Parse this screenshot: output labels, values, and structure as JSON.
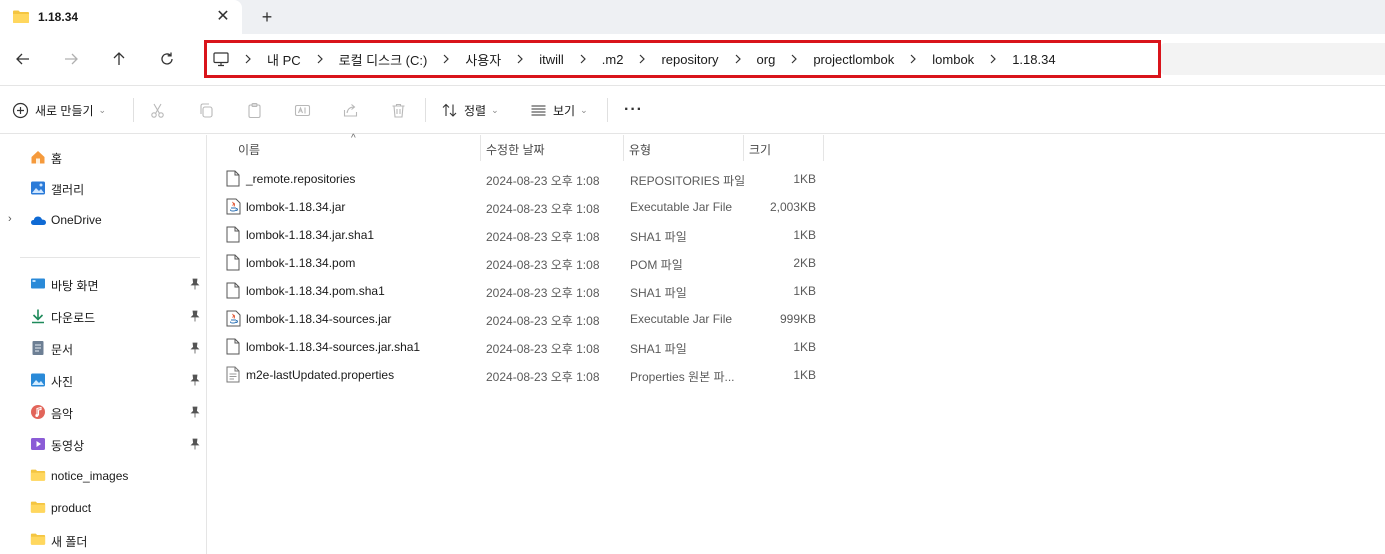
{
  "tab": {
    "title": "1.18.34",
    "close": "✕",
    "new_tab": "+"
  },
  "breadcrumb": [
    "내 PC",
    "로컬 디스크 (C:)",
    "사용자",
    "itwill",
    ".m2",
    "repository",
    "org",
    "projectlombok",
    "lombok",
    "1.18.34"
  ],
  "toolbar": {
    "new_label": "새로 만들기",
    "sort_label": "정렬",
    "view_label": "보기",
    "more_label": "···"
  },
  "sidebar": {
    "items": [
      {
        "label": "홈",
        "icon": "home-icon"
      },
      {
        "label": "갤러리",
        "icon": "gallery-icon"
      },
      {
        "label": "OneDrive",
        "icon": "cloud-icon"
      },
      {
        "label": "바탕 화면",
        "icon": "desktop-icon"
      },
      {
        "label": "다운로드",
        "icon": "download-icon"
      },
      {
        "label": "문서",
        "icon": "document-icon"
      },
      {
        "label": "사진",
        "icon": "pictures-icon"
      },
      {
        "label": "음악",
        "icon": "music-icon"
      },
      {
        "label": "동영상",
        "icon": "video-icon"
      },
      {
        "label": "notice_images",
        "icon": "folder-icon"
      },
      {
        "label": "product",
        "icon": "folder-icon"
      },
      {
        "label": "새 폴더",
        "icon": "folder-icon"
      }
    ]
  },
  "columns": {
    "name": "이름",
    "date": "수정한 날짜",
    "type": "유형",
    "size": "크기"
  },
  "files": [
    {
      "name": "_remote.repositories",
      "date": "2024-08-23 오후 1:08",
      "type": "REPOSITORIES 파일",
      "size": "1KB",
      "icon": "file-icon"
    },
    {
      "name": "lombok-1.18.34.jar",
      "date": "2024-08-23 오후 1:08",
      "type": "Executable Jar File",
      "size": "2,003KB",
      "icon": "java-jar-icon"
    },
    {
      "name": "lombok-1.18.34.jar.sha1",
      "date": "2024-08-23 오후 1:08",
      "type": "SHA1 파일",
      "size": "1KB",
      "icon": "file-icon"
    },
    {
      "name": "lombok-1.18.34.pom",
      "date": "2024-08-23 오후 1:08",
      "type": "POM 파일",
      "size": "2KB",
      "icon": "file-icon"
    },
    {
      "name": "lombok-1.18.34.pom.sha1",
      "date": "2024-08-23 오후 1:08",
      "type": "SHA1 파일",
      "size": "1KB",
      "icon": "file-icon"
    },
    {
      "name": "lombok-1.18.34-sources.jar",
      "date": "2024-08-23 오후 1:08",
      "type": "Executable Jar File",
      "size": "999KB",
      "icon": "java-jar-icon"
    },
    {
      "name": "lombok-1.18.34-sources.jar.sha1",
      "date": "2024-08-23 오후 1:08",
      "type": "SHA1 파일",
      "size": "1KB",
      "icon": "file-icon"
    },
    {
      "name": "m2e-lastUpdated.properties",
      "date": "2024-08-23 오후 1:08",
      "type": "Properties 원본 파...",
      "size": "1KB",
      "icon": "properties-file-icon"
    }
  ],
  "colors": {
    "highlight_border": "#d9141b",
    "folder": "#f4c542",
    "accent": "#0067c0"
  }
}
